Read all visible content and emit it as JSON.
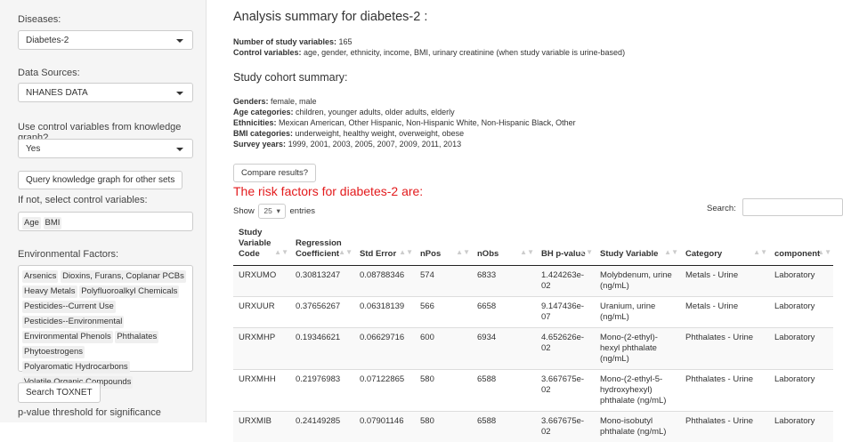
{
  "sidebar": {
    "diseases_label": "Diseases:",
    "diseases_value": "Diabetes-2",
    "sources_label": "Data Sources:",
    "sources_value": "NHANES DATA",
    "use_control_label": "Use control variables from knowledge graph?",
    "use_control_value": "Yes",
    "query_button": "Query knowledge graph for other sets",
    "if_not_label": "If not, select control variables:",
    "control_tags": [
      "Age",
      "BMI"
    ],
    "env_label": "Environmental Factors:",
    "env_tags": [
      "Arsenics",
      "Dioxins, Furans, Coplanar PCBs",
      "Heavy Metals",
      "Polyfluoroalkyl Chemicals",
      "Pesticides--Current Use",
      "Pesticides--Environmental",
      "Environmental Phenols",
      "Phthalates",
      "Phytoestrogens",
      "Polyaromatic Hydrocarbons",
      "Volatile Organic Compounds"
    ],
    "toxnet_button": "Search TOXNET",
    "pvalue_label": "p-value threshold for significance"
  },
  "main": {
    "title": "Analysis summary for diabetes-2 :",
    "num_vars_label": "Number of study variables:",
    "num_vars_value": "165",
    "control_label": "Control variables:",
    "control_value": "age, gender, ethnicity, income, BMI, urinary creatinine (when study variable is urine-based)",
    "cohort_title": "Study cohort summary:",
    "genders_label": "Genders:",
    "genders_value": "female, male",
    "age_label": "Age categories:",
    "age_value": "children, younger adults, older adults, elderly",
    "eth_label": "Ethnicities:",
    "eth_value": "Mexican American, Other Hispanic, Non-Hispanic White, Non-Hispanic Black, Other",
    "bmi_label": "BMI categories:",
    "bmi_value": "underweight, healthy weight, overweight, obese",
    "years_label": "Survey years:",
    "years_value": "1999, 2001, 2003, 2005, 2007, 2009, 2011, 2013",
    "compare_button": "Compare results?",
    "risk_title": "The risk factors for diabetes-2 are:",
    "show_label": "Show",
    "entries_value": "25",
    "entries_label": "entries",
    "search_label": "Search:"
  },
  "table": {
    "headers": [
      "Study Variable Code",
      "Regression Coefficient",
      "Std Error",
      "nPos",
      "nObs",
      "BH p-value",
      "Study Variable",
      "Category",
      "component"
    ],
    "rows": [
      [
        "URXUMO",
        "0.30813247",
        "0.08788346",
        "574",
        "6833",
        "1.424263e-02",
        "Molybdenum, urine (ng/mL)",
        "Metals - Urine",
        "Laboratory"
      ],
      [
        "URXUUR",
        "0.37656267",
        "0.06318139",
        "566",
        "6658",
        "9.147436e-07",
        "Uranium, urine (ng/mL)",
        "Metals - Urine",
        "Laboratory"
      ],
      [
        "URXMHP",
        "0.19346621",
        "0.06629716",
        "600",
        "6934",
        "4.652626e-02",
        "Mono-(2-ethyl)-hexyl phthalate (ng/mL)",
        "Phthalates - Urine",
        "Laboratory"
      ],
      [
        "URXMHH",
        "0.21976983",
        "0.07122865",
        "580",
        "6588",
        "3.667675e-02",
        "Mono-(2-ethyl-5-hydroxyhexyl) phthalate (ng/mL)",
        "Phthalates - Urine",
        "Laboratory"
      ],
      [
        "URXMIB",
        "0.24149285",
        "0.07901146",
        "580",
        "6588",
        "3.667675e-02",
        "Mono-isobutyl phthalate (ng/mL)",
        "Phthalates - Urine",
        "Laboratory"
      ]
    ]
  }
}
